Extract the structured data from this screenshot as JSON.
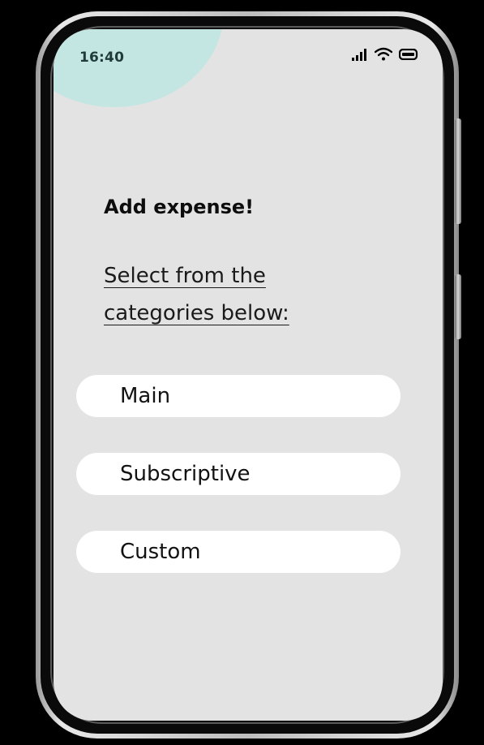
{
  "status_bar": {
    "time": "16:40",
    "icons": [
      "signal-icon",
      "wifi-icon",
      "battery-icon"
    ]
  },
  "page": {
    "heading": "Add expense!",
    "subheading": "Select from the categories below:"
  },
  "categories": [
    {
      "label": "Main"
    },
    {
      "label": "Subscriptive"
    },
    {
      "label": "Custom"
    }
  ],
  "colors": {
    "screen_background": "#e3e3e3",
    "accent_blob": "#c3e6e3",
    "button_background": "#ffffff",
    "time_text": "#1f3b3b"
  }
}
